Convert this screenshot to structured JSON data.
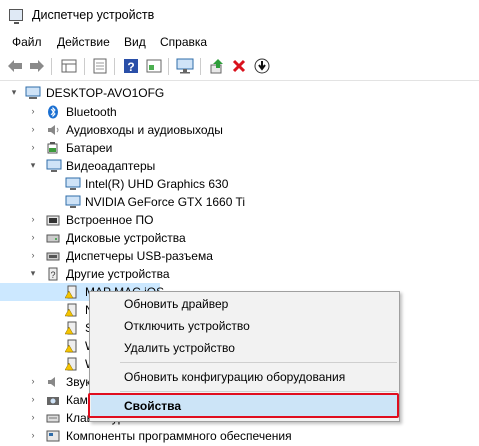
{
  "window": {
    "title": "Диспетчер устройств",
    "icon": "device-manager-icon"
  },
  "menu": [
    "Файл",
    "Действие",
    "Вид",
    "Справка"
  ],
  "toolbar": {
    "buttons": [
      "back-arrow-icon",
      "forward-arrow-icon",
      "properties-grid-icon",
      "document-icon",
      "help-icon",
      "view-icon",
      "monitor-icon",
      "update-driver-icon",
      "uninstall-red-x-icon",
      "download-circle-icon"
    ]
  },
  "tree": {
    "root": "DESKTOP-AVO1OFG",
    "items": [
      {
        "label": "Bluetooth",
        "icon": "bluetooth-icon",
        "expanded": false
      },
      {
        "label": "Аудиовходы и аудиовыходы",
        "icon": "speaker-icon",
        "expanded": false
      },
      {
        "label": "Батареи",
        "icon": "battery-icon",
        "expanded": false
      },
      {
        "label": "Видеоадаптеры",
        "icon": "display-adapter-icon",
        "expanded": true
      },
      {
        "label": "Intel(R) UHD Graphics 630",
        "icon": "display-adapter-icon",
        "child": true
      },
      {
        "label": "NVIDIA GeForce GTX 1660 Ti",
        "icon": "display-adapter-icon",
        "child": true
      },
      {
        "label": "Встроенное ПО",
        "icon": "firmware-icon",
        "expanded": false
      },
      {
        "label": "Дисковые устройства",
        "icon": "disk-icon",
        "expanded": false
      },
      {
        "label": "Диспетчеры USB-разъема",
        "icon": "usb-icon",
        "expanded": false
      },
      {
        "label": "Другие устройства",
        "icon": "unknown-device-icon",
        "expanded": true
      },
      {
        "label": "MAP MAC iOS",
        "icon": "unknown-device-warning-icon",
        "child": true,
        "selected": true
      },
      {
        "label": "N",
        "icon": "unknown-device-warning-icon",
        "child": true
      },
      {
        "label": "S",
        "icon": "unknown-device-warning-icon",
        "child": true
      },
      {
        "label": "W",
        "icon": "unknown-device-warning-icon",
        "child": true
      },
      {
        "label": "W",
        "icon": "unknown-device-warning-icon",
        "child": true
      },
      {
        "label": "Звук",
        "icon": "sound-icon",
        "expanded": false
      },
      {
        "label": "Камеры",
        "icon": "camera-icon",
        "expanded": false
      },
      {
        "label": "Клавиатуры",
        "icon": "keyboard-icon",
        "expanded": false
      },
      {
        "label": "Компоненты программного обеспечения",
        "icon": "software-component-icon",
        "expanded": false
      }
    ]
  },
  "context_menu": {
    "items": [
      {
        "label": "Обновить драйвер"
      },
      {
        "label": "Отключить устройство"
      },
      {
        "label": "Удалить устройство"
      },
      {
        "label": "Обновить конфигурацию оборудования"
      },
      {
        "label": "Свойства",
        "bold": true,
        "highlighted": true
      }
    ]
  },
  "colors": {
    "highlight": "#cce4f7",
    "callout": "#e00d1e",
    "selection": "#cce8ff"
  }
}
